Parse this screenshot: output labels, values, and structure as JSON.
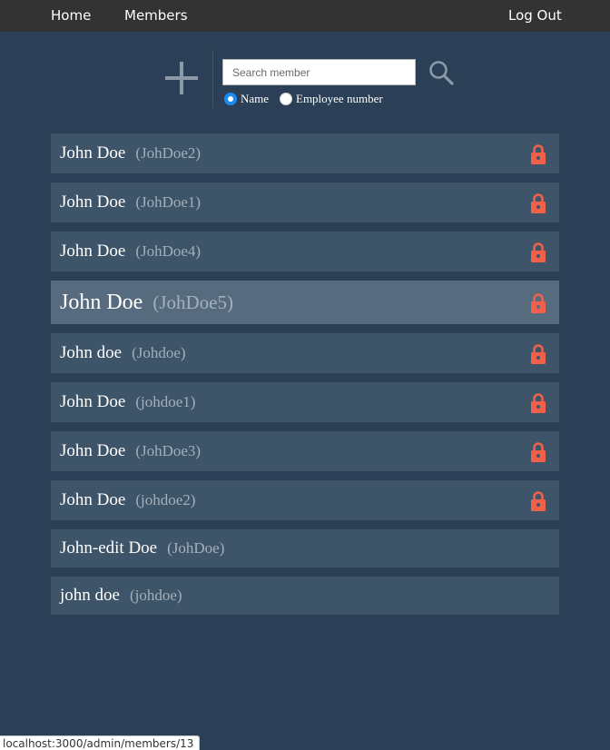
{
  "nav": {
    "home_label": "Home",
    "members_label": "Members",
    "logout_label": "Log Out"
  },
  "toolbar": {
    "add_icon": "plus-icon",
    "search_placeholder": "Search member",
    "search_value": "",
    "search_icon": "magnifier-icon",
    "radio_options": [
      {
        "label": "Name",
        "checked": true
      },
      {
        "label": "Employee number",
        "checked": false
      }
    ]
  },
  "members": [
    {
      "name": "John Doe",
      "id": "(JohDoe2)",
      "locked": true
    },
    {
      "name": "John Doe",
      "id": "(JohDoe1)",
      "locked": true
    },
    {
      "name": "John Doe",
      "id": "(JohDoe4)",
      "locked": true
    },
    {
      "name": "John Doe",
      "id": "(JohDoe5)",
      "locked": true,
      "highlighted": true
    },
    {
      "name": "John doe",
      "id": "(Johdoe)",
      "locked": true
    },
    {
      "name": "John Doe",
      "id": "(johdoe1)",
      "locked": true
    },
    {
      "name": "John Doe",
      "id": "(JohDoe3)",
      "locked": true
    },
    {
      "name": "John Doe",
      "id": "(johdoe2)",
      "locked": true
    },
    {
      "name": "John-edit Doe",
      "id": "(JohDoe)",
      "locked": false
    },
    {
      "name": "john doe",
      "id": "(johdoe)",
      "locked": false
    }
  ],
  "status_bar": {
    "url": "localhost:3000/admin/members/13"
  },
  "colors": {
    "page_background": "#2b4056",
    "navbar": "#333333",
    "row_background": "#3e5468",
    "row_highlight": "#576b7f",
    "lock_icon": "#f0604a",
    "radio_checked": "#1a8cf0"
  }
}
